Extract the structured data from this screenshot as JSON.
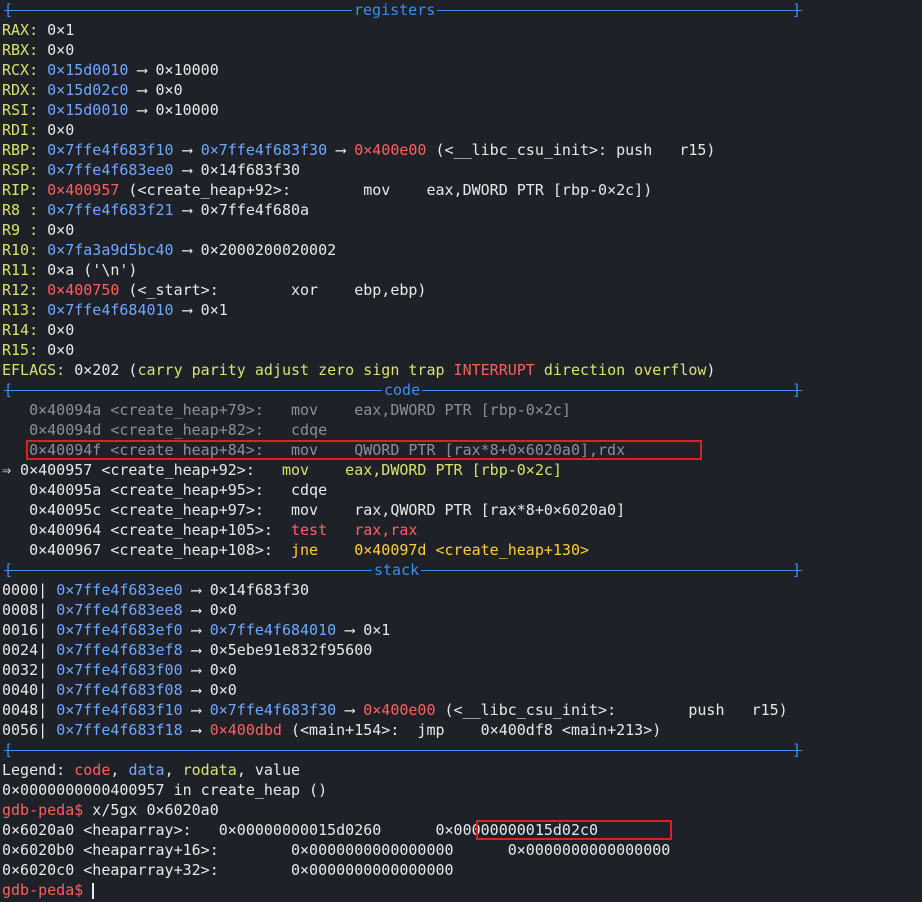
{
  "separators": {
    "registers": "registers",
    "code": "code",
    "stack": "stack"
  },
  "registers": [
    {
      "name": "RAX:",
      "parts": [
        {
          "t": " 0×1",
          "c": ""
        }
      ]
    },
    {
      "name": "RBX:",
      "parts": [
        {
          "t": " 0×0",
          "c": ""
        }
      ]
    },
    {
      "name": "RCX:",
      "parts": [
        {
          "t": " ",
          "c": ""
        },
        {
          "t": "0×15d0010",
          "c": "addr"
        },
        {
          "t": " ⟶ 0×10000",
          "c": ""
        }
      ]
    },
    {
      "name": "RDX:",
      "parts": [
        {
          "t": " ",
          "c": ""
        },
        {
          "t": "0×15d02c0",
          "c": "addr"
        },
        {
          "t": " ⟶ 0×0",
          "c": ""
        }
      ]
    },
    {
      "name": "RSI:",
      "parts": [
        {
          "t": " ",
          "c": ""
        },
        {
          "t": "0×15d0010",
          "c": "addr"
        },
        {
          "t": " ⟶ 0×10000",
          "c": ""
        }
      ]
    },
    {
      "name": "RDI:",
      "parts": [
        {
          "t": " 0×0",
          "c": ""
        }
      ]
    },
    {
      "name": "RBP:",
      "parts": [
        {
          "t": " ",
          "c": ""
        },
        {
          "t": "0×7ffe4f683f10",
          "c": "addr"
        },
        {
          "t": " ⟶ ",
          "c": ""
        },
        {
          "t": "0×7ffe4f683f30",
          "c": "addr"
        },
        {
          "t": " ⟶ ",
          "c": ""
        },
        {
          "t": "0×400e00",
          "c": "red"
        },
        {
          "t": " (<__libc_csu_init>: push   r15)",
          "c": ""
        }
      ]
    },
    {
      "name": "RSP:",
      "parts": [
        {
          "t": " ",
          "c": ""
        },
        {
          "t": "0×7ffe4f683ee0",
          "c": "addr"
        },
        {
          "t": " ⟶ 0×14f683f30",
          "c": ""
        }
      ]
    },
    {
      "name": "RIP:",
      "parts": [
        {
          "t": " ",
          "c": ""
        },
        {
          "t": "0×400957",
          "c": "red"
        },
        {
          "t": " (<create_heap+92>:        mov    eax,DWORD PTR [rbp-0×2c])",
          "c": ""
        }
      ]
    },
    {
      "name": "R8 :",
      "parts": [
        {
          "t": " ",
          "c": ""
        },
        {
          "t": "0×7ffe4f683f21",
          "c": "addr"
        },
        {
          "t": " ⟶ 0×7ffe4f680a",
          "c": ""
        }
      ]
    },
    {
      "name": "R9 :",
      "parts": [
        {
          "t": " 0×0",
          "c": ""
        }
      ]
    },
    {
      "name": "R10:",
      "parts": [
        {
          "t": " ",
          "c": ""
        },
        {
          "t": "0×7fa3a9d5bc40",
          "c": "addr"
        },
        {
          "t": " ⟶ 0×2000200020002",
          "c": ""
        }
      ]
    },
    {
      "name": "R11:",
      "parts": [
        {
          "t": " 0×a ('\\n')",
          "c": ""
        }
      ]
    },
    {
      "name": "R12:",
      "parts": [
        {
          "t": " ",
          "c": ""
        },
        {
          "t": "0×400750",
          "c": "red"
        },
        {
          "t": " (<_start>:        xor    ebp,ebp)",
          "c": ""
        }
      ]
    },
    {
      "name": "R13:",
      "parts": [
        {
          "t": " ",
          "c": ""
        },
        {
          "t": "0×7ffe4f684010",
          "c": "addr"
        },
        {
          "t": " ⟶ 0×1",
          "c": ""
        }
      ]
    },
    {
      "name": "R14:",
      "parts": [
        {
          "t": " 0×0",
          "c": ""
        }
      ]
    },
    {
      "name": "R15:",
      "parts": [
        {
          "t": " 0×0",
          "c": ""
        }
      ]
    }
  ],
  "eflags": {
    "name": "EFLAGS:",
    "value": " 0×202 (",
    "flags_a": "carry parity adjust zero sign trap ",
    "flag_set": "INTERRUPT",
    "flags_b": " direction overflow",
    "close": ")"
  },
  "code": [
    {
      "cls": "dim",
      "parts": [
        {
          "t": "   0×40094a <create_heap+79>:   mov    eax,DWORD PTR [rbp-0×2c]",
          "c": "dim"
        }
      ]
    },
    {
      "cls": "dim",
      "parts": [
        {
          "t": "   0×40094d <create_heap+82>:   cdqe",
          "c": "dim"
        }
      ]
    },
    {
      "cls": "dim",
      "parts": [
        {
          "t": "   0×40094f <create_heap+84>:   mov    QWORD PTR [rax*8+0×6020a0],rdx",
          "c": "dim"
        }
      ]
    },
    {
      "cls": "",
      "parts": [
        {
          "t": "⇒ 0×400957 <create_heap+92>:   ",
          "c": ""
        },
        {
          "t": "mov    eax,DWORD PTR [rbp-0×2c]",
          "c": "green"
        }
      ]
    },
    {
      "cls": "",
      "parts": [
        {
          "t": "   0×40095a <create_heap+95>:   cdqe",
          "c": ""
        }
      ]
    },
    {
      "cls": "",
      "parts": [
        {
          "t": "   0×40095c <create_heap+97>:   mov    rax,QWORD PTR [rax*8+0×6020a0]",
          "c": ""
        }
      ]
    },
    {
      "cls": "",
      "parts": [
        {
          "t": "   0×400964 <create_heap+105>:  ",
          "c": ""
        },
        {
          "t": "test   rax,rax",
          "c": "red"
        }
      ]
    },
    {
      "cls": "",
      "parts": [
        {
          "t": "   0×400967 <create_heap+108>:  ",
          "c": ""
        },
        {
          "t": "jne    0×40097d <create_heap+130>",
          "c": "yellow"
        }
      ]
    }
  ],
  "stack": [
    {
      "off": "0000|",
      "parts": [
        {
          "t": " ",
          "c": ""
        },
        {
          "t": "0×7ffe4f683ee0",
          "c": "addr"
        },
        {
          "t": " ⟶ 0×14f683f30",
          "c": ""
        }
      ]
    },
    {
      "off": "0008|",
      "parts": [
        {
          "t": " ",
          "c": ""
        },
        {
          "t": "0×7ffe4f683ee8",
          "c": "addr"
        },
        {
          "t": " ⟶ 0×0",
          "c": ""
        }
      ]
    },
    {
      "off": "0016|",
      "parts": [
        {
          "t": " ",
          "c": ""
        },
        {
          "t": "0×7ffe4f683ef0",
          "c": "addr"
        },
        {
          "t": " ⟶ ",
          "c": ""
        },
        {
          "t": "0×7ffe4f684010",
          "c": "addr"
        },
        {
          "t": " ⟶ 0×1",
          "c": ""
        }
      ]
    },
    {
      "off": "0024|",
      "parts": [
        {
          "t": " ",
          "c": ""
        },
        {
          "t": "0×7ffe4f683ef8",
          "c": "addr"
        },
        {
          "t": " ⟶ 0×5ebe91e832f95600",
          "c": ""
        }
      ]
    },
    {
      "off": "0032|",
      "parts": [
        {
          "t": " ",
          "c": ""
        },
        {
          "t": "0×7ffe4f683f00",
          "c": "addr"
        },
        {
          "t": " ⟶ 0×0",
          "c": ""
        }
      ]
    },
    {
      "off": "0040|",
      "parts": [
        {
          "t": " ",
          "c": ""
        },
        {
          "t": "0×7ffe4f683f08",
          "c": "addr"
        },
        {
          "t": " ⟶ 0×0",
          "c": ""
        }
      ]
    },
    {
      "off": "0048|",
      "parts": [
        {
          "t": " ",
          "c": ""
        },
        {
          "t": "0×7ffe4f683f10",
          "c": "addr"
        },
        {
          "t": " ⟶ ",
          "c": ""
        },
        {
          "t": "0×7ffe4f683f30",
          "c": "addr"
        },
        {
          "t": " ⟶ ",
          "c": ""
        },
        {
          "t": "0×400e00",
          "c": "red"
        },
        {
          "t": " (<__libc_csu_init>:        push   r15)",
          "c": ""
        }
      ]
    },
    {
      "off": "0056|",
      "parts": [
        {
          "t": " ",
          "c": ""
        },
        {
          "t": "0×7ffe4f683f18",
          "c": "addr"
        },
        {
          "t": " ⟶ ",
          "c": ""
        },
        {
          "t": "0×400dbd",
          "c": "red"
        },
        {
          "t": " (<main+154>:  jmp    0×400df8 <main+213>)",
          "c": ""
        }
      ]
    }
  ],
  "legend": {
    "label": "Legend: ",
    "code": "code",
    "comma1": ", ",
    "data": "data",
    "comma2": ", ",
    "rodata": "rodata",
    "comma3": ", ",
    "value": "value"
  },
  "location_line": "0×0000000000400957 in create_heap ()",
  "prompt": "gdb-peda$",
  "command": " x/5gx 0×6020a0",
  "memory": [
    {
      "label": "0×6020a0 <heaparray>:   ",
      "v1": "0×00000000015d0260",
      "gap": "      ",
      "v2": "0×00000000015d02c0"
    },
    {
      "label": "0×6020b0 <heaparray+16>:        ",
      "v1": "0×0000000000000000",
      "gap": "      ",
      "v2": "0×0000000000000000"
    },
    {
      "label": "0×6020c0 <heaparray+32>:        ",
      "v1": "0×0000000000000000",
      "gap": "",
      "v2": ""
    }
  ],
  "colors": {
    "background": "#1f2128",
    "separator": "#3b8eea",
    "register_name": "#d7e36d",
    "address": "#6fa8ff",
    "code_address": "#ff5f5f",
    "highlight_box": "#e02020"
  }
}
